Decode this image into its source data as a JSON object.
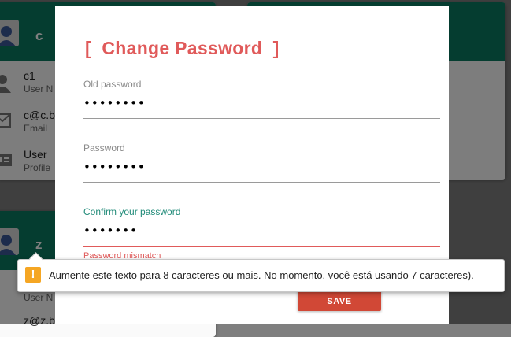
{
  "background_cards": [
    {
      "initial": "c",
      "rows": [
        {
          "icon": "person-icon",
          "main": "c1",
          "sub": "User N"
        },
        {
          "icon": "envelope-icon",
          "main": "c@c.b",
          "sub": "Email"
        },
        {
          "icon": "id-card-icon",
          "main": "User",
          "sub": "Profile"
        }
      ]
    },
    {
      "initial": "z",
      "rows": [
        {
          "icon": "person-icon",
          "main": "",
          "sub": "User N"
        },
        {
          "icon": "envelope-icon",
          "main": "z@z.b",
          "sub": ""
        }
      ]
    }
  ],
  "dialog": {
    "title": "[  Change Password  ]",
    "fields": [
      {
        "label": "Old password",
        "value": "••••••••"
      },
      {
        "label": "Password",
        "value": "••••••••"
      },
      {
        "label": "Confirm your password",
        "value": "•••••••",
        "error": "Password mismatch"
      }
    ],
    "save_label": "SAVE"
  },
  "validation_tooltip": {
    "icon": "warning-icon",
    "icon_glyph": "!",
    "text": "Aumente este texto para 8 caracteres ou mais. No momento, você está usando 7 caracteres)."
  },
  "colors": {
    "header_green": "#0b7a60",
    "title_red": "#e05a5a",
    "save_button": "#d14836",
    "active_label": "#1f8a78",
    "warning_orange": "#f5a623"
  }
}
